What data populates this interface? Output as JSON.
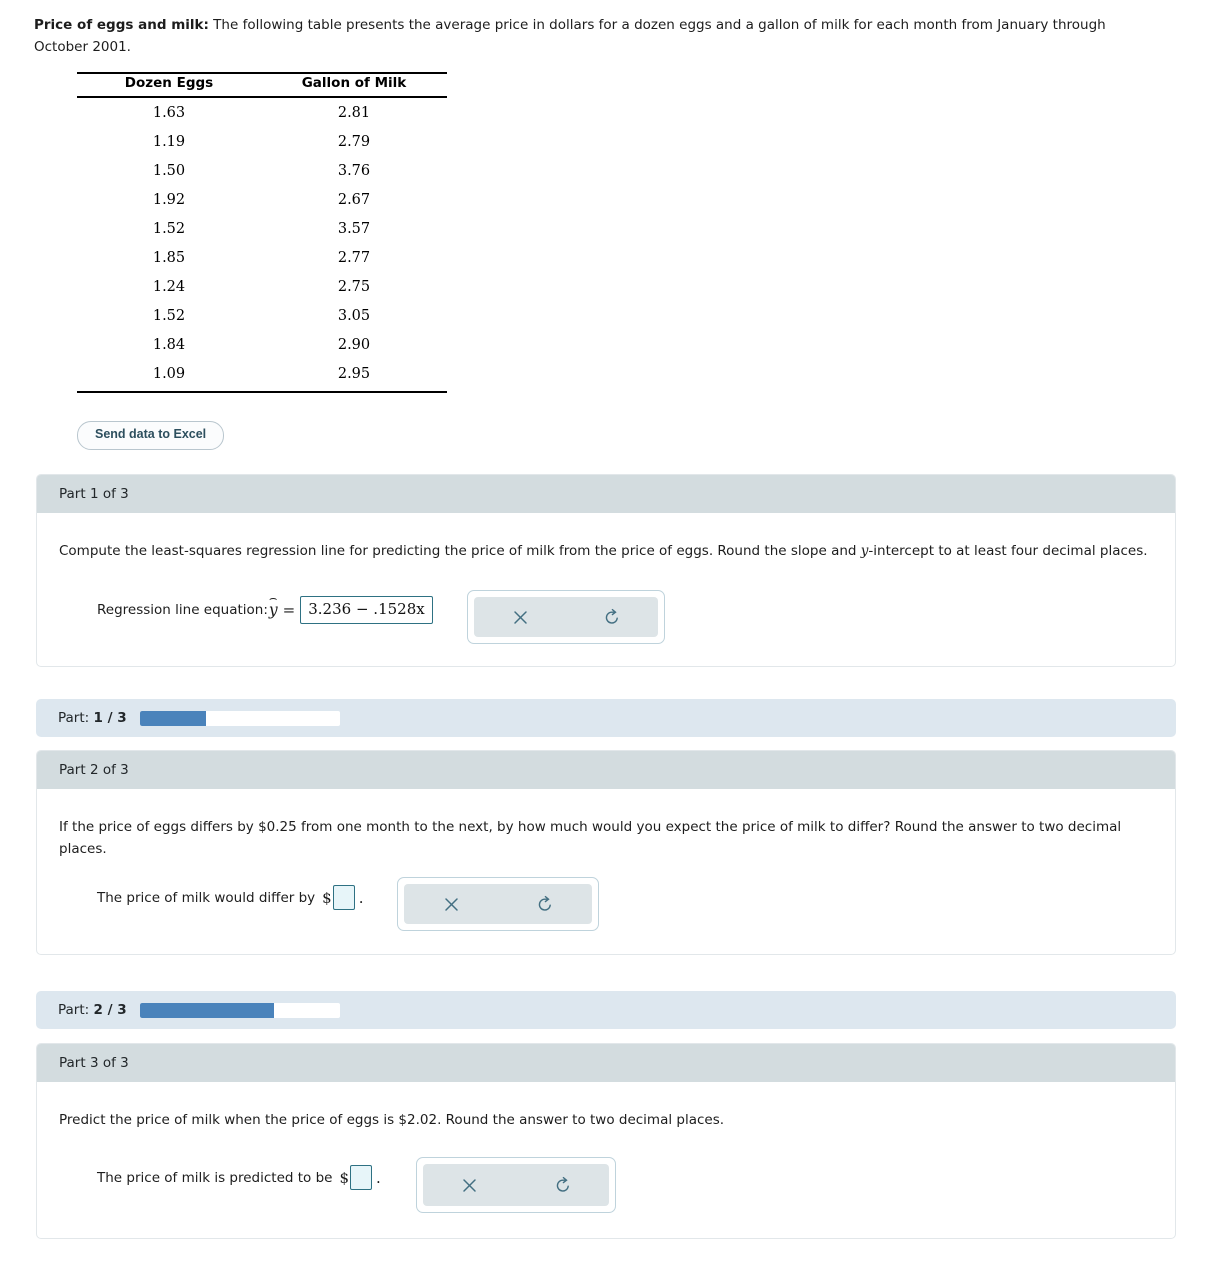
{
  "intro": {
    "lead": "Price of eggs and milk:",
    "body": " The following table presents the average price in dollars for a dozen eggs and a gallon of milk for each month from January through October 2001."
  },
  "table": {
    "headers": [
      "Dozen Eggs",
      "Gallon of Milk"
    ],
    "rows": [
      [
        "1.63",
        "2.81"
      ],
      [
        "1.19",
        "2.79"
      ],
      [
        "1.50",
        "3.76"
      ],
      [
        "1.92",
        "2.67"
      ],
      [
        "1.52",
        "3.57"
      ],
      [
        "1.85",
        "2.77"
      ],
      [
        "1.24",
        "2.75"
      ],
      [
        "1.52",
        "3.05"
      ],
      [
        "1.84",
        "2.90"
      ],
      [
        "1.09",
        "2.95"
      ]
    ]
  },
  "excel_button": {
    "label": "Send data to Excel"
  },
  "part1": {
    "header": "Part 1 of 3",
    "question": "Compute the least-squares regression line for predicting the price of milk from the price of eggs. Round the slope and y-intercept to at least four decimal places.",
    "question_pre": "Compute the least-squares regression line for predicting the price of milk from the price of eggs. Round the slope and ",
    "question_var": "y",
    "question_post": "-intercept to at least four decimal places.",
    "answer_label": "Regression line equation:",
    "yhat_symbol": "y",
    "hat_symbol": "⌢",
    "equals": "=",
    "input_value": "3.236 − .1528x"
  },
  "progress1": {
    "label_prefix": "Part:",
    "label_value": "1 / 3",
    "percent": 33
  },
  "part2": {
    "header": "Part 2 of 3",
    "question": "If the price of eggs differs by $0.25 from one month to the next, by how much would you expect the price of milk to differ? Round the answer to two decimal places.",
    "answer_label": "The price of milk would differ by",
    "dollar_sign": "$",
    "input_value": "",
    "trailing_period": "."
  },
  "progress2": {
    "label_prefix": "Part:",
    "label_value": "2 / 3",
    "percent": 67
  },
  "part3": {
    "header": "Part 3 of 3",
    "question": "Predict the price of milk when the price of eggs is $2.02. Round the answer to two decimal places.",
    "answer_label": "The price of milk is predicted to be",
    "dollar_sign": "$",
    "input_value": "",
    "trailing_period": "."
  },
  "icons": {
    "clear": "close-x-icon",
    "undo": "undo-arrow-icon"
  },
  "colors": {
    "header_band": "#d3dcdf",
    "progress_band": "#dde7ef",
    "progress_fill": "#4a83bb",
    "input_border": "#2e7183",
    "action_icon": "#436f82"
  }
}
